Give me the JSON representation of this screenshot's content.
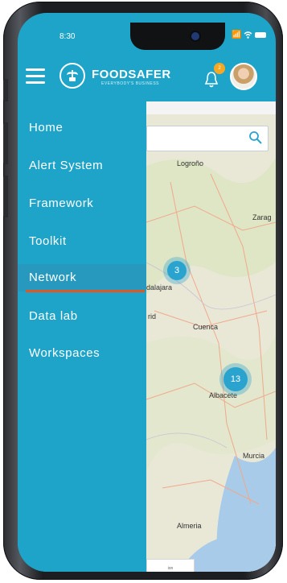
{
  "status_bar": {
    "time": "8:30",
    "signal": "📶"
  },
  "header": {
    "brand": "FOODSAFER",
    "tagline": "EVERYBODY'S BUSINESS",
    "notification_count": "2"
  },
  "nav": {
    "items": [
      {
        "label": "Home"
      },
      {
        "label": "Alert System"
      },
      {
        "label": "Framework"
      },
      {
        "label": "Toolkit"
      },
      {
        "label": "Network",
        "active": true
      },
      {
        "label": "Data lab"
      },
      {
        "label": "Workspaces"
      }
    ]
  },
  "map": {
    "cities": [
      "Logroño",
      "Zarag",
      "dalajara",
      "rid",
      "Cuenca",
      "Albacete",
      "Murcia",
      "Almeria"
    ],
    "clusters": [
      {
        "count": "3"
      },
      {
        "count": "13"
      }
    ],
    "bottom_input_text": "ion"
  },
  "colors": {
    "primary": "#1fa4c9",
    "active_underline": "#e2561f",
    "badge": "#f7a823"
  }
}
